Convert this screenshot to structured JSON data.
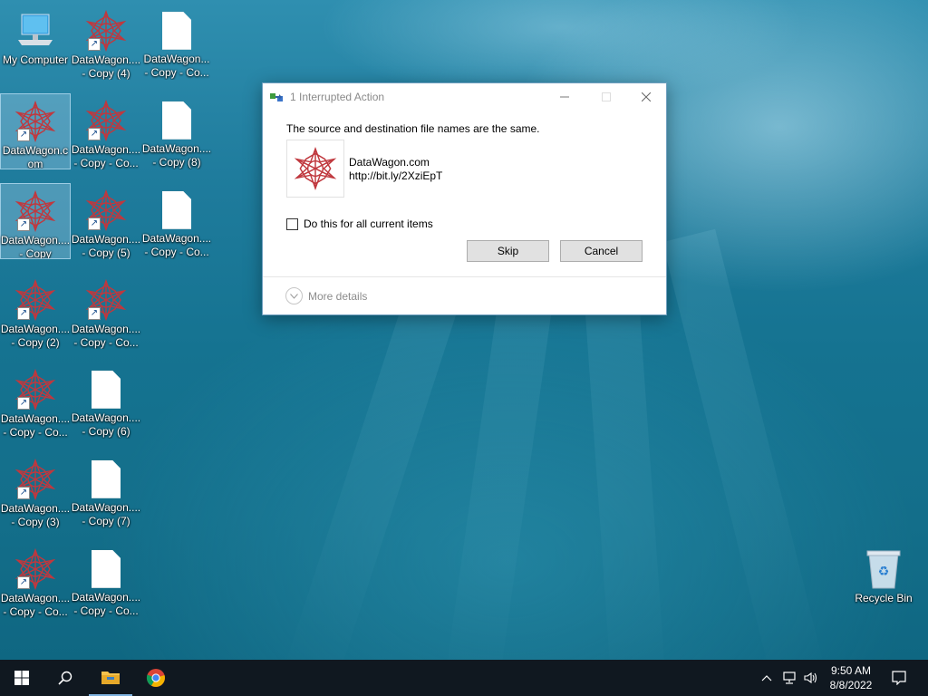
{
  "desktop": {
    "icons": [
      {
        "label": "My Computer"
      },
      {
        "label": "DataWagon.... - Copy (4)"
      },
      {
        "label": "DataWagon... - Copy - Co..."
      },
      {
        "label": "DataWagon.com"
      },
      {
        "label": "DataWagon.... - Copy - Co..."
      },
      {
        "label": "DataWagon.... - Copy (8)"
      },
      {
        "label": "DataWagon.... - Copy"
      },
      {
        "label": "DataWagon.... - Copy (5)"
      },
      {
        "label": "DataWagon.... - Copy - Co..."
      },
      {
        "label": "DataWagon.... - Copy (2)"
      },
      {
        "label": "DataWagon.... - Copy - Co..."
      },
      {
        "label": "DataWagon.... - Copy - Co..."
      },
      {
        "label": "DataWagon.... - Copy (6)"
      },
      {
        "label": "DataWagon.... - Copy (3)"
      },
      {
        "label": "DataWagon.... - Copy (7)"
      },
      {
        "label": "DataWagon.... - Copy - Co..."
      },
      {
        "label": "DataWagon.... - Copy - Co..."
      },
      {
        "label": "Recycle Bin"
      }
    ]
  },
  "dialog": {
    "title": "1 Interrupted Action",
    "message": "The source and destination file names are the same.",
    "file_name": "DataWagon.com",
    "file_url": "http://bit.ly/2XziEpT",
    "checkbox_label": "Do this for all current items",
    "checkbox_checked": false,
    "skip_label": "Skip",
    "cancel_label": "Cancel",
    "more_details_label": "More details",
    "icon": "datawagon-logo-icon"
  },
  "taskbar": {
    "time": "9:50 AM",
    "date": "8/8/2022",
    "pinned": [
      "start-icon",
      "search-icon",
      "file-explorer-icon",
      "chrome-icon"
    ],
    "tray": [
      "chevron-up-icon",
      "network-icon",
      "volume-icon",
      "notification-icon"
    ]
  },
  "colors": {
    "taskbar": "#101820",
    "dialog_border": "#6f9fbf",
    "button_bg": "#e1e1e1",
    "logo_red": "#c0383e"
  }
}
